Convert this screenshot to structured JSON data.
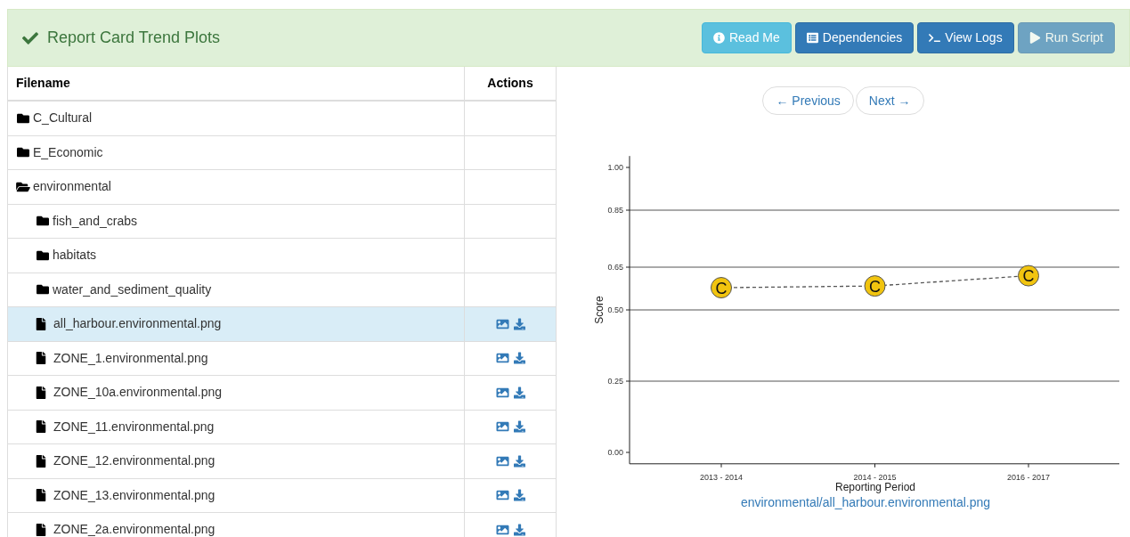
{
  "header": {
    "title": "Report Card Trend Plots"
  },
  "toolbar": [
    {
      "label": "Read Me",
      "kind": "info",
      "disabled": false
    },
    {
      "label": "Dependencies",
      "kind": "list",
      "disabled": false
    },
    {
      "label": "View Logs",
      "kind": "terminal",
      "disabled": false
    },
    {
      "label": "Run Script",
      "kind": "play",
      "disabled": true
    }
  ],
  "file_table": {
    "columns": [
      "Filename",
      "Actions"
    ],
    "rows": [
      {
        "kind": "folder",
        "name": "C_Cultural",
        "expanded": false,
        "selected": false
      },
      {
        "kind": "folder",
        "name": "E_Economic",
        "expanded": false,
        "selected": false
      },
      {
        "kind": "folder",
        "name": "environmental",
        "expanded": true,
        "selected": false,
        "children": [
          {
            "kind": "folder",
            "name": "fish_and_crabs",
            "expanded": false,
            "selected": false
          },
          {
            "kind": "folder",
            "name": "habitats",
            "expanded": false,
            "selected": false
          },
          {
            "kind": "folder",
            "name": "water_and_sediment_quality",
            "expanded": false,
            "selected": false
          },
          {
            "kind": "file",
            "name": "all_harbour.environmental.png",
            "selected": true
          },
          {
            "kind": "file",
            "name": "ZONE_1.environmental.png",
            "selected": false
          },
          {
            "kind": "file",
            "name": "ZONE_10a.environmental.png",
            "selected": false
          },
          {
            "kind": "file",
            "name": "ZONE_11.environmental.png",
            "selected": false
          },
          {
            "kind": "file",
            "name": "ZONE_12.environmental.png",
            "selected": false
          },
          {
            "kind": "file",
            "name": "ZONE_13.environmental.png",
            "selected": false
          },
          {
            "kind": "file",
            "name": "ZONE_2a.environmental.png",
            "selected": false
          }
        ]
      }
    ]
  },
  "pager": {
    "previous": "← Previous",
    "next": "Next →"
  },
  "viewer": {
    "chart_data": {
      "type": "line",
      "xlabel": "Reporting Period",
      "ylabel": "Score",
      "categories": [
        "2013 - 2014",
        "2014 - 2015",
        "2016 - 2017"
      ],
      "series": [
        {
          "color": "#f1c40f",
          "line_style": "dashed",
          "marker": "circle",
          "values": [
            0.578,
            0.584,
            0.62
          ]
        }
      ],
      "ylim": [
        -0.04,
        1.04
      ],
      "grid": true,
      "yticks": [
        {
          "value": 0,
          "label": "0.00"
        },
        {
          "value": 0.25,
          "label": "0.25"
        },
        {
          "value": 0.5,
          "label": "0.50"
        },
        {
          "value": 0.65,
          "label": "0.65"
        },
        {
          "value": 0.85,
          "label": "0.85"
        },
        {
          "value": 1,
          "label": "1.00"
        }
      ],
      "value_labels": [
        "C",
        "C",
        "C"
      ]
    },
    "caption": "environmental/all_harbour.environmental.png"
  }
}
